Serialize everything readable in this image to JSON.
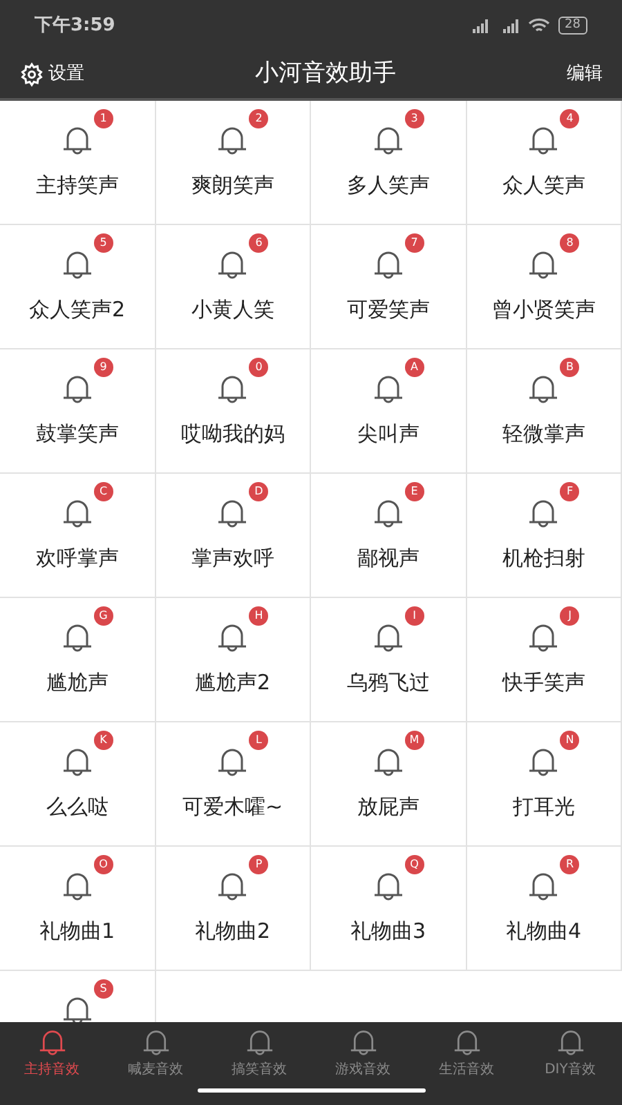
{
  "status_bar": {
    "time": "下午3:59",
    "battery": "28"
  },
  "header": {
    "settings": "设置",
    "title": "小河音效助手",
    "edit": "编辑"
  },
  "sounds": [
    {
      "badge": "1",
      "label": "主持笑声"
    },
    {
      "badge": "2",
      "label": "爽朗笑声"
    },
    {
      "badge": "3",
      "label": "多人笑声"
    },
    {
      "badge": "4",
      "label": "众人笑声"
    },
    {
      "badge": "5",
      "label": "众人笑声2"
    },
    {
      "badge": "6",
      "label": "小黄人笑"
    },
    {
      "badge": "7",
      "label": "可爱笑声"
    },
    {
      "badge": "8",
      "label": "曾小贤笑声"
    },
    {
      "badge": "9",
      "label": "鼓掌笑声"
    },
    {
      "badge": "0",
      "label": "哎呦我的妈"
    },
    {
      "badge": "A",
      "label": "尖叫声"
    },
    {
      "badge": "B",
      "label": "轻微掌声"
    },
    {
      "badge": "C",
      "label": "欢呼掌声"
    },
    {
      "badge": "D",
      "label": "掌声欢呼"
    },
    {
      "badge": "E",
      "label": "鄙视声"
    },
    {
      "badge": "F",
      "label": "机枪扫射"
    },
    {
      "badge": "G",
      "label": "尴尬声"
    },
    {
      "badge": "H",
      "label": "尴尬声2"
    },
    {
      "badge": "I",
      "label": "乌鸦飞过"
    },
    {
      "badge": "J",
      "label": "快手笑声"
    },
    {
      "badge": "K",
      "label": "么么哒"
    },
    {
      "badge": "L",
      "label": "可爱木嚯~"
    },
    {
      "badge": "M",
      "label": "放屁声"
    },
    {
      "badge": "N",
      "label": "打耳光"
    },
    {
      "badge": "O",
      "label": "礼物曲1"
    },
    {
      "badge": "P",
      "label": "礼物曲2"
    },
    {
      "badge": "Q",
      "label": "礼物曲3"
    },
    {
      "badge": "R",
      "label": "礼物曲4"
    },
    {
      "badge": "S"
    }
  ],
  "tabs": [
    {
      "label": "主持音效",
      "selected": true
    },
    {
      "label": "喊麦音效",
      "selected": false
    },
    {
      "label": "搞笑音效",
      "selected": false
    },
    {
      "label": "游戏音效",
      "selected": false
    },
    {
      "label": "生活音效",
      "selected": false
    },
    {
      "label": "DIY音效",
      "selected": false
    }
  ]
}
